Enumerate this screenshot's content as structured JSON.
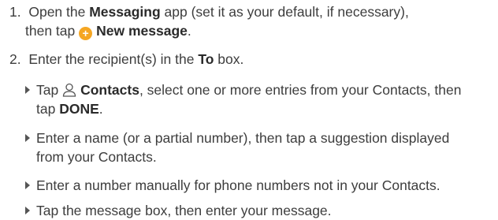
{
  "steps": [
    {
      "number": "1.",
      "line1_pre": "Open the ",
      "line1_bold": "Messaging",
      "line1_post": " app (set it as your default, if necessary),",
      "line2_pre": "then tap ",
      "line2_bold": "New message",
      "line2_post": "."
    },
    {
      "number": "2.",
      "pre": "Enter the recipient(s) in the ",
      "bold": "To",
      "post": " box."
    }
  ],
  "bullets": {
    "contacts": {
      "pre": "Tap ",
      "bold": "Contacts",
      "post": ", select one or more entries from your Contacts, then",
      "line2_pre": "tap ",
      "line2_bold": "DONE",
      "line2_post": "."
    },
    "name": {
      "line1": "Enter a name (or a partial number), then tap a suggestion displayed",
      "line2": "from your Contacts."
    },
    "manual": {
      "line1": "Enter a number manually for phone numbers not in your Contacts."
    },
    "message": {
      "line1": "Tap the message box, then enter your message."
    }
  },
  "icons": {
    "new_message": "plus-circle-icon",
    "contacts": "person-icon",
    "bullet": "triangle-bullet-icon"
  },
  "colors": {
    "accent": "#f5a623",
    "text": "#3d3d3d"
  }
}
